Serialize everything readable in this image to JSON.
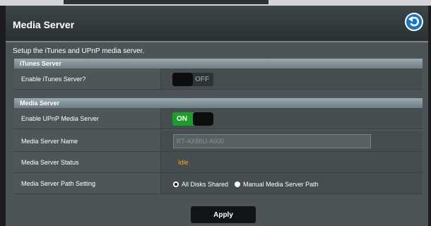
{
  "page": {
    "title": "Media Server",
    "subtitle": "Setup the iTunes and UPnP media server."
  },
  "itunes": {
    "section_title": "iTunes Server",
    "enable_label": "Enable iTunes Server?",
    "enable_state": "OFF"
  },
  "media": {
    "section_title": "Media Server",
    "upnp_label": "Enable UPnP Media Server",
    "upnp_state": "ON",
    "name_label": "Media Server Name",
    "name_value": "RT-AX86U-A000",
    "status_label": "Media Server Status",
    "status_value": "Idle",
    "path_label": "Media Server Path Setting",
    "path_options": [
      "All Disks Shared",
      "Manual Media Server Path"
    ],
    "path_selected": "All Disks Shared"
  },
  "actions": {
    "apply_label": "Apply"
  },
  "icons": {
    "back": "back-arrow-icon"
  },
  "colors": {
    "toggle_on": "#1d9e2c",
    "status_idle": "#ffa523",
    "back_icon": "#1a74c4"
  }
}
